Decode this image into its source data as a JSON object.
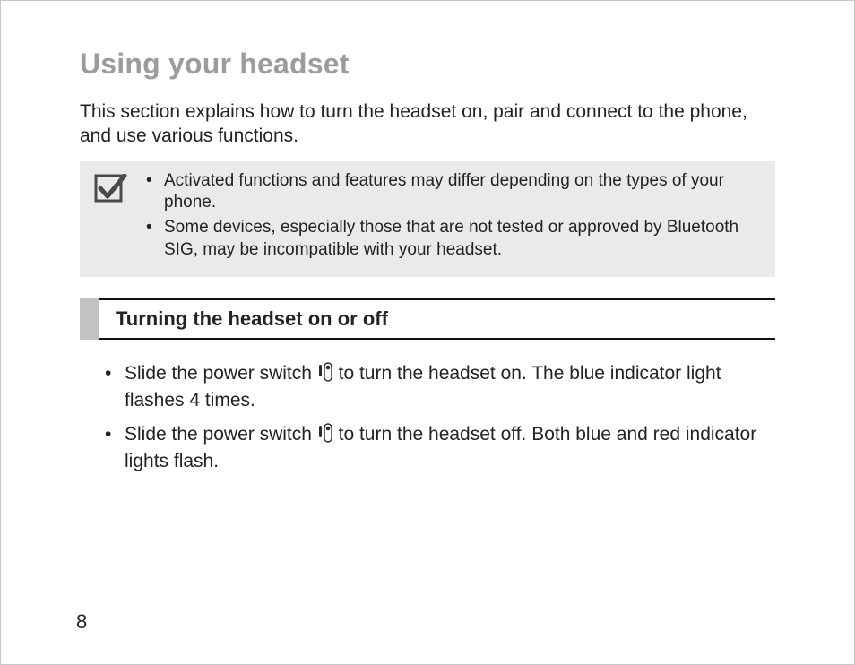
{
  "title": "Using your headset",
  "intro": "This section explains how to turn the headset on, pair and connect to the phone, and use various functions.",
  "note": {
    "items": [
      "Activated functions and features may differ depending on the types of your phone.",
      "Some devices, especially those that are not tested or approved by Bluetooth SIG, may be incompatible with your headset."
    ]
  },
  "subsection_title": "Turning the headset on or off",
  "instructions": {
    "on": {
      "pre": "Slide the power switch ",
      "post": " to turn the headset on. The blue indicator light flashes 4 times."
    },
    "off": {
      "pre": "Slide the power switch ",
      "post": " to turn the headset off. Both blue and red indicator lights flash."
    }
  },
  "page_number": "8"
}
